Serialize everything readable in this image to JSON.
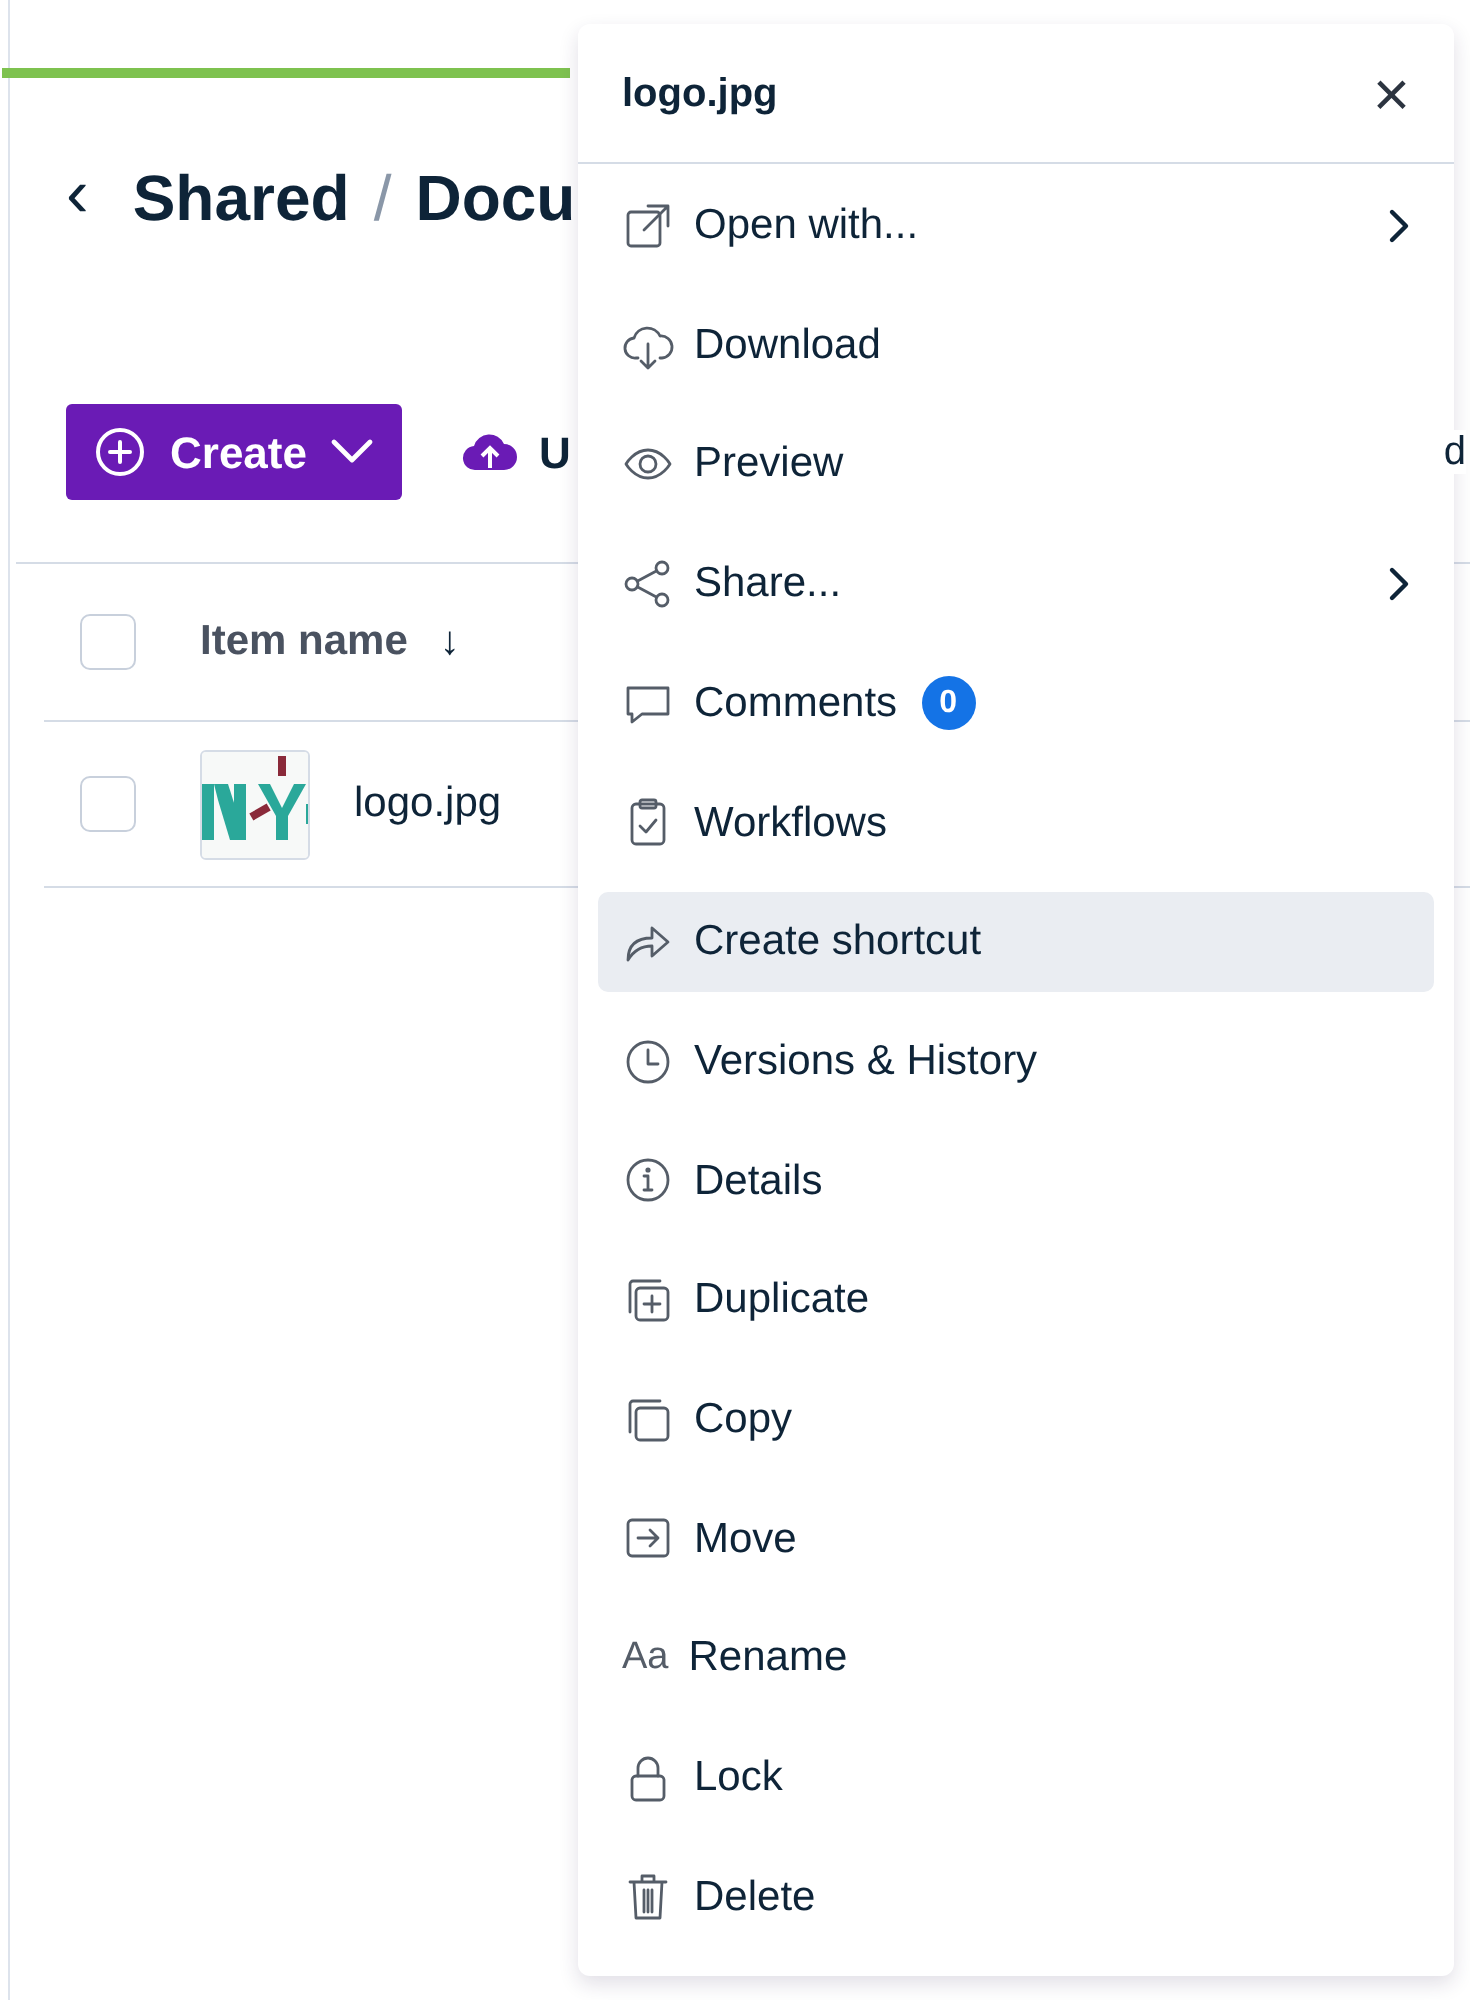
{
  "breadcrumb": {
    "back": "‹",
    "parts": [
      "Shared",
      "Docu"
    ],
    "separator": "/"
  },
  "toolbar": {
    "create": "Create",
    "upload_partial": "U",
    "right_partial": "d"
  },
  "table": {
    "columns": [
      {
        "label": "Item name",
        "sort": "↓",
        "checked": false
      }
    ],
    "rows": [
      {
        "name": "logo.jpg",
        "checked": false
      }
    ]
  },
  "menu": {
    "title": "logo.jpg",
    "close": "×",
    "items": [
      {
        "label": "Open with...",
        "submenu": true,
        "selected": false
      },
      {
        "label": "Download",
        "submenu": false,
        "selected": false
      },
      {
        "label": "Preview",
        "submenu": false,
        "selected": false
      },
      {
        "label": "Share...",
        "submenu": true,
        "selected": false
      },
      {
        "label": "Comments",
        "submenu": false,
        "selected": false,
        "badge": "0"
      },
      {
        "label": "Workflows",
        "submenu": false,
        "selected": false
      },
      {
        "label": "Create shortcut",
        "submenu": false,
        "selected": true
      },
      {
        "label": "Versions & History",
        "submenu": false,
        "selected": false
      },
      {
        "label": "Details",
        "submenu": false,
        "selected": false
      },
      {
        "label": "Duplicate",
        "submenu": false,
        "selected": false
      },
      {
        "label": "Copy",
        "submenu": false,
        "selected": false
      },
      {
        "label": "Move",
        "submenu": false,
        "selected": false
      },
      {
        "label": "Rename",
        "submenu": false,
        "selected": false,
        "icon_text": "Aa"
      },
      {
        "label": "Lock",
        "submenu": false,
        "selected": false
      },
      {
        "label": "Delete",
        "submenu": false,
        "selected": false
      }
    ]
  }
}
